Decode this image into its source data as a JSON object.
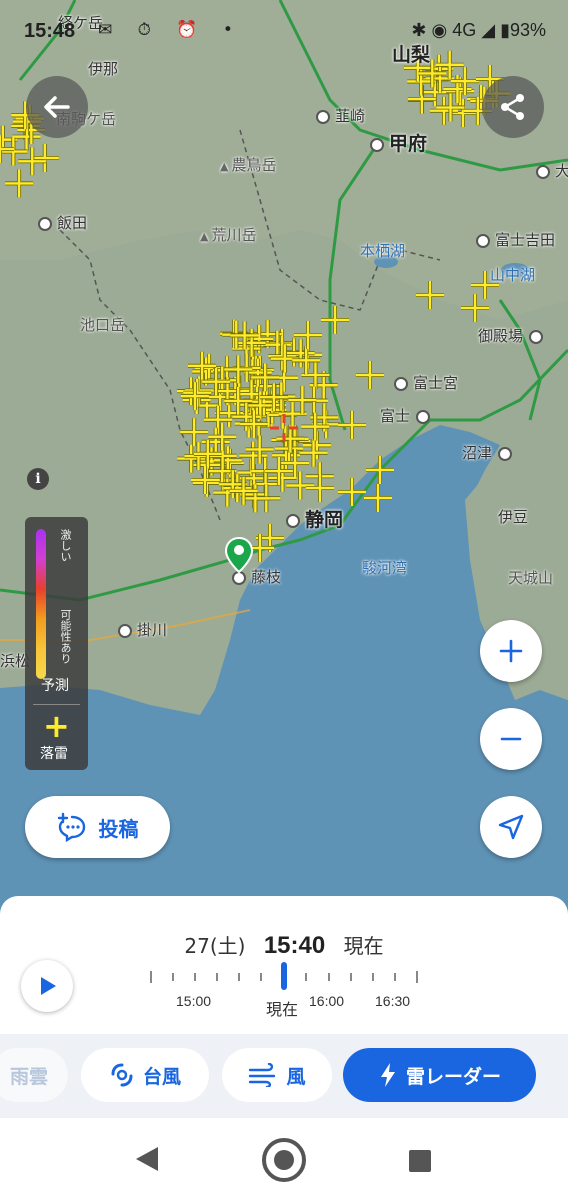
{
  "status_bar": {
    "time": "15:48",
    "network": "4G",
    "battery": "93%"
  },
  "map": {
    "places": {
      "ina": "伊那",
      "komagane": "南駒ケ岳",
      "nirasaki": "韮崎",
      "kofu": "甲府",
      "yamanashi": "山梨",
      "noutori": "農鳥岳",
      "iida": "飯田",
      "arakawa": "荒川岳",
      "motosu": "本栖湖",
      "fujiyoshida": "富士吉田",
      "yamanaka": "山中湖",
      "ikeguchi": "池口岳",
      "gotemba": "御殿場",
      "fujinomiya": "富士宮",
      "fuji": "富士",
      "numazu": "沼津",
      "shizuoka": "静岡",
      "fujieda": "藤枝",
      "surugawan": "駿河湾",
      "izu": "伊豆",
      "amagi": "天城山",
      "kakegawa": "掛川",
      "hamamatsu": "浜松",
      "partial_top": "経ケ岳",
      "partial_right": "大"
    },
    "lightning_color": "#ffea2b"
  },
  "legend": {
    "intense": "激しい",
    "possible": "可能性あり",
    "forecast": "予測",
    "strike": "落雷"
  },
  "post_button": {
    "label": "投稿"
  },
  "timeline": {
    "day": "27(土)",
    "time": "15:40",
    "now": "現在",
    "ticks": [
      "15:00",
      "16:00",
      "16:30"
    ],
    "cursor_label": "現在"
  },
  "tabs": [
    {
      "label": "雨雲"
    },
    {
      "label": "台風"
    },
    {
      "label": "風"
    },
    {
      "label": "雷レーダー"
    }
  ],
  "colors": {
    "accent": "#1a66e0",
    "sea": "#5f93b6",
    "land": "#9cab95"
  }
}
